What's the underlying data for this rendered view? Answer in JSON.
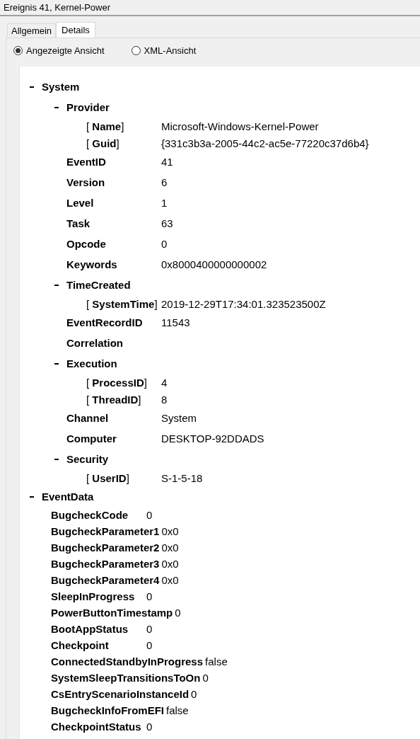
{
  "window": {
    "title": "Ereignis 41, Kernel-Power"
  },
  "tabs": [
    {
      "label": "Allgemein",
      "selected": false
    },
    {
      "label": "Details",
      "selected": true
    }
  ],
  "view_options": [
    {
      "label": "Angezeigte Ansicht",
      "selected": true
    },
    {
      "label": "XML-Ansicht",
      "selected": false
    }
  ],
  "tree": [
    {
      "kind": "group",
      "name": "System",
      "expanded": true,
      "children": [
        {
          "kind": "group",
          "name": "Provider",
          "expanded": true,
          "children": [
            {
              "kind": "attr",
              "name": "[ **Name**]",
              "value": "Microsoft-Windows-Kernel-Power"
            },
            {
              "kind": "attr",
              "name": "[ **Guid**]",
              "value": "{331c3b3a-2005-44c2-ac5e-77220c37d6b4}"
            }
          ]
        },
        {
          "kind": "field",
          "name": "EventID",
          "value": "41"
        },
        {
          "kind": "field",
          "name": "Version",
          "value": "6"
        },
        {
          "kind": "field",
          "name": "Level",
          "value": "1"
        },
        {
          "kind": "field",
          "name": "Task",
          "value": "63"
        },
        {
          "kind": "field",
          "name": "Opcode",
          "value": "0"
        },
        {
          "kind": "field",
          "name": "Keywords",
          "value": "0x8000400000000002"
        },
        {
          "kind": "group",
          "name": "TimeCreated",
          "expanded": true,
          "children": [
            {
              "kind": "attr",
              "name": "[ **SystemTime**]",
              "value": "2019-12-29T17:34:01.323523500Z"
            }
          ]
        },
        {
          "kind": "field",
          "name": "EventRecordID",
          "value": "11543"
        },
        {
          "kind": "field",
          "name": "Correlation"
        },
        {
          "kind": "group",
          "name": "Execution",
          "expanded": true,
          "children": [
            {
              "kind": "attr",
              "name": "[ **ProcessID**]",
              "value": "4"
            },
            {
              "kind": "attr",
              "name": "[ **ThreadID**]",
              "value": "8"
            }
          ]
        },
        {
          "kind": "field",
          "name": "Channel",
          "value": "System"
        },
        {
          "kind": "field",
          "name": "Computer",
          "value": "DESKTOP-92DDADS"
        },
        {
          "kind": "group",
          "name": "Security",
          "expanded": true,
          "children": [
            {
              "kind": "attr",
              "name": "[ **UserID**]",
              "value": "S-1-5-18"
            }
          ]
        }
      ]
    },
    {
      "kind": "group",
      "name": "EventData",
      "expanded": true,
      "children": [
        {
          "kind": "data",
          "name": "BugcheckCode",
          "value": "0"
        },
        {
          "kind": "data",
          "name": "BugcheckParameter1",
          "value": "0x0"
        },
        {
          "kind": "data",
          "name": "BugcheckParameter2",
          "value": "0x0"
        },
        {
          "kind": "data",
          "name": "BugcheckParameter3",
          "value": "0x0"
        },
        {
          "kind": "data",
          "name": "BugcheckParameter4",
          "value": "0x0"
        },
        {
          "kind": "data",
          "name": "SleepInProgress",
          "value": "0"
        },
        {
          "kind": "data",
          "name": "PowerButtonTimestamp",
          "value": "0"
        },
        {
          "kind": "data",
          "name": "BootAppStatus",
          "value": "0"
        },
        {
          "kind": "data",
          "name": "Checkpoint",
          "value": "0"
        },
        {
          "kind": "data",
          "name": "ConnectedStandbyInProgress",
          "value": "false"
        },
        {
          "kind": "data",
          "name": "SystemSleepTransitionsToOn",
          "value": "0"
        },
        {
          "kind": "data",
          "name": "CsEntryScenarioInstanceId",
          "value": "0"
        },
        {
          "kind": "data",
          "name": "BugcheckInfoFromEFI",
          "value": "false"
        },
        {
          "kind": "data",
          "name": "CheckpointStatus",
          "value": "0"
        }
      ]
    }
  ]
}
